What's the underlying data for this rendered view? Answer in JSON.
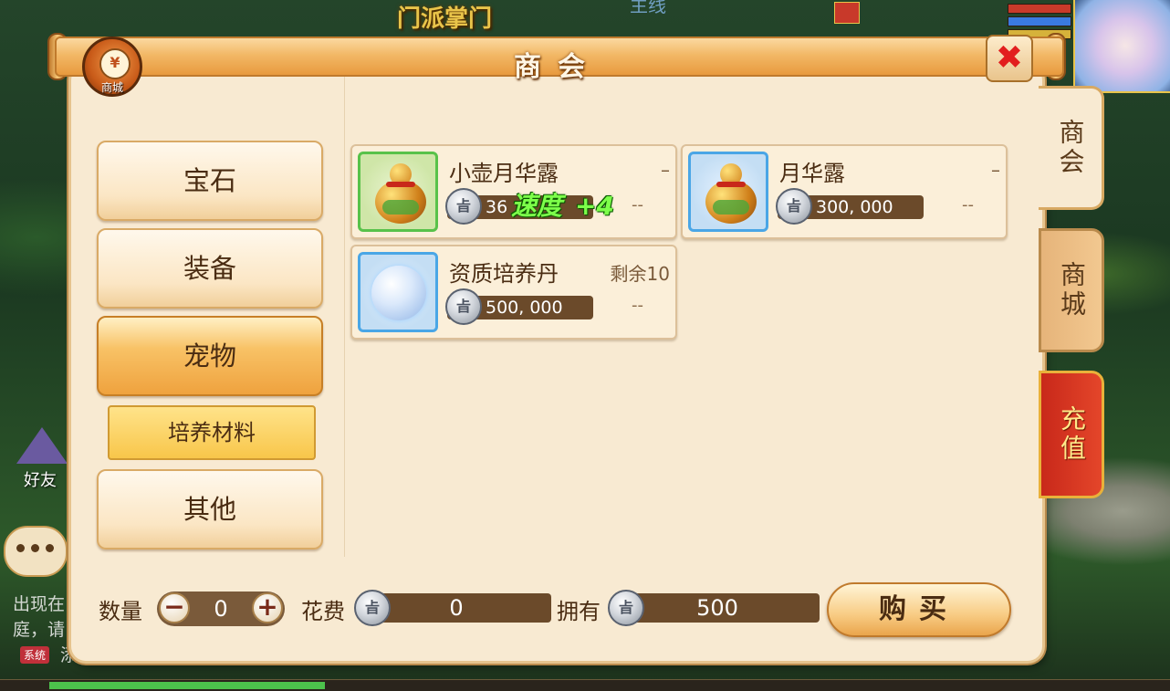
{
  "background": {
    "top_banner": "门派掌门",
    "top_banner_faded": "主线",
    "hp_colors": [
      "#c83a2a",
      "#3a7ae0",
      "#d6b23a"
    ],
    "left_widget_label": "好友",
    "chat_lines": [
      "出现在",
      "庭，请"
    ],
    "system_tag": "系统",
    "chat_tail": "添"
  },
  "window": {
    "title": "商会",
    "badge_icon": "¥",
    "badge_label": "商城",
    "close_label": "✖"
  },
  "right_tabs": [
    {
      "label": "商会",
      "active": true
    },
    {
      "label": "商城",
      "active": false
    },
    {
      "label": "充值",
      "active": false
    }
  ],
  "categories": [
    {
      "label": "宝石",
      "active": false
    },
    {
      "label": "装备",
      "active": false
    },
    {
      "label": "宠物",
      "active": true
    },
    {
      "label": "其他",
      "active": false
    }
  ],
  "subcategory": {
    "label": "培养材料",
    "selected": true
  },
  "items": [
    {
      "name": "小壶月华露",
      "stock": "–",
      "price": "36",
      "limit": "--",
      "icon": "gourd-icon",
      "frame": "green"
    },
    {
      "name": "月华露",
      "stock": "–",
      "price": "300, 000",
      "limit": "--",
      "icon": "gourd-icon",
      "frame": "blue"
    },
    {
      "name": "资质培养丹",
      "stock": "剩余10",
      "price": "500, 000",
      "limit": "--",
      "icon": "pearl-icon",
      "frame": "blue"
    }
  ],
  "float_text": {
    "label": "速度",
    "value": "+4"
  },
  "coin_glyph": "㫖",
  "bottom": {
    "quantity_label": "数量",
    "quantity_value": "0",
    "minus": "−",
    "plus": "+",
    "cost_label": "花费",
    "cost_value": "0",
    "own_label": "拥有",
    "own_value": "500",
    "buy_label": "购买"
  },
  "colors": {
    "accent": "#efa23e",
    "subcategory_bg": "#f8c64a",
    "recharge_tab": "#d6341f",
    "close_x": "#e21e1e"
  }
}
